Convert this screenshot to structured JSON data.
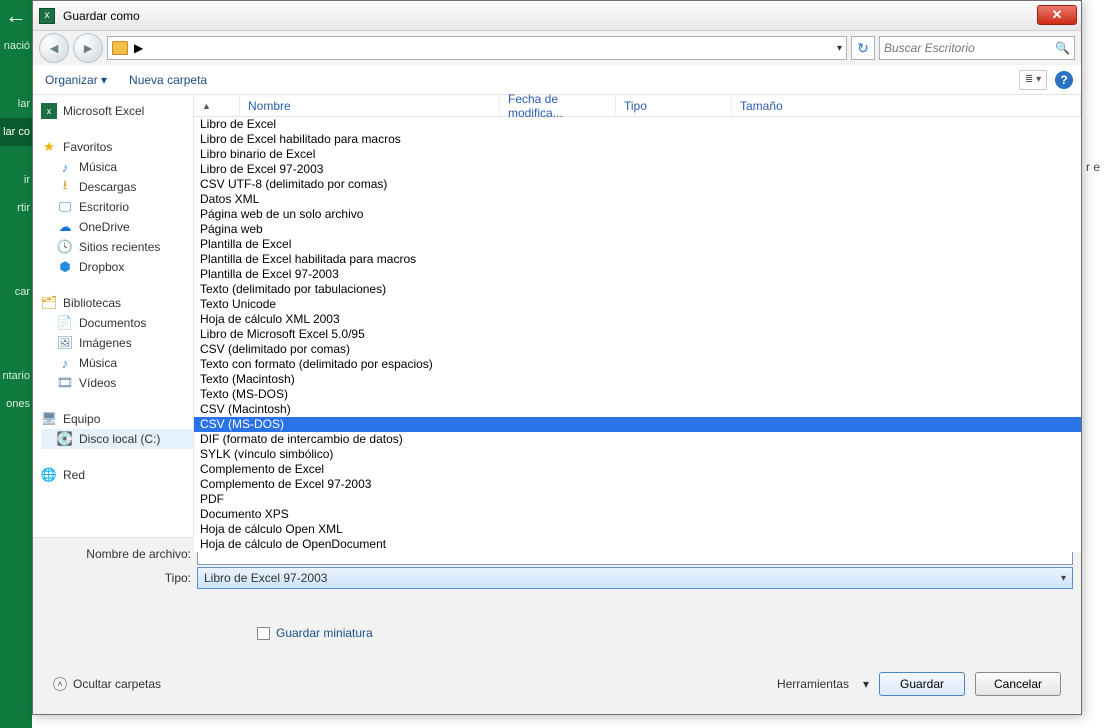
{
  "ribbon": {
    "items": [
      "nació",
      "lar",
      "lar co",
      "ir",
      "rtir",
      "car",
      "ntario",
      "ones"
    ],
    "activeIndex": 2
  },
  "truncated_label": "r e",
  "dialog": {
    "title": "Guardar como",
    "close_tooltip": "Cerrar",
    "path_sep": "▶",
    "address_dd": "▾",
    "refresh_glyph": "↻",
    "search_placeholder": "Buscar Escritorio",
    "toolbar": {
      "organize": "Organizar ▾",
      "new_folder": "Nueva carpeta"
    },
    "columns": {
      "name": "Nombre",
      "date": "Fecha de modifica...",
      "type": "Tipo",
      "size": "Tamaño",
      "sort_glyph": "▲"
    },
    "side": {
      "excel": "Microsoft Excel",
      "fav": "Favoritos",
      "fav_items": [
        "Música",
        "Descargas",
        "Escritorio",
        "OneDrive",
        "Sitios recientes",
        "Dropbox"
      ],
      "libs": "Bibliotecas",
      "lib_items": [
        "Documentos",
        "Imágenes",
        "Música",
        "Vídeos"
      ],
      "equipo": "Equipo",
      "disk": "Disco local (C:)",
      "red": "Red"
    },
    "type_options": [
      "Libro de Excel",
      "Libro de Excel habilitado para macros",
      "Libro binario de Excel",
      "Libro de Excel 97-2003",
      "CSV UTF-8 (delimitado por comas)",
      "Datos XML",
      "Página web de un solo archivo",
      "Página web",
      "Plantilla de Excel",
      "Plantilla de Excel habilitada para macros",
      "Plantilla de Excel 97-2003",
      "Texto (delimitado por tabulaciones)",
      "Texto Unicode",
      "Hoja de cálculo XML 2003",
      "Libro de Microsoft Excel 5.0/95",
      "CSV (delimitado por comas)",
      "Texto con formato (delimitado por espacios)",
      "Texto (Macintosh)",
      "Texto (MS-DOS)",
      "CSV (Macintosh)",
      "CSV (MS-DOS)",
      "DIF (formato de intercambio de datos)",
      "SYLK (vínculo simbólico)",
      "Complemento de Excel",
      "Complemento de Excel 97-2003",
      "PDF",
      "Documento XPS",
      "Hoja de cálculo Open XML",
      "Hoja de cálculo de OpenDocument"
    ],
    "type_selected_index": 20,
    "labels": {
      "filename": "Nombre de archivo:",
      "type": "Tipo:",
      "type_value": "Libro de Excel 97-2003",
      "thumb": "Guardar miniatura",
      "hide": "Ocultar carpetas",
      "tools": "Herramientas",
      "tools_dd": "▾",
      "save": "Guardar",
      "cancel": "Cancelar"
    }
  }
}
